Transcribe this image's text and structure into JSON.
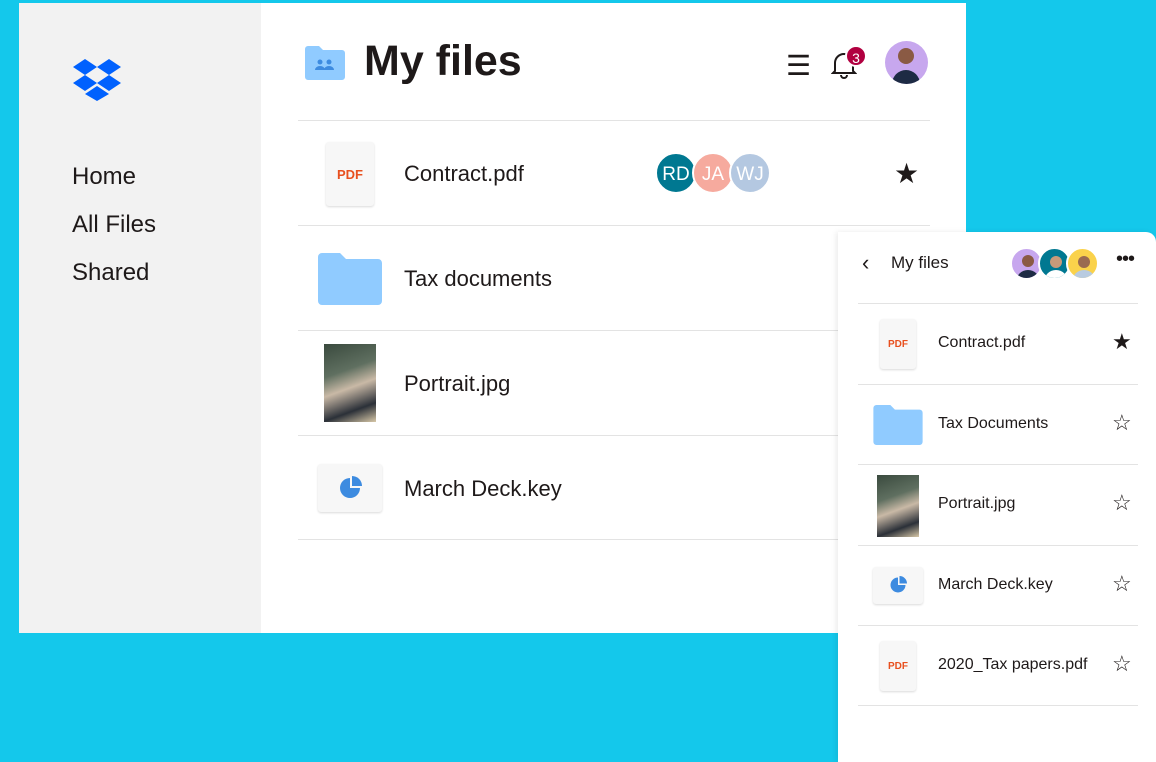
{
  "colors": {
    "background": "#14c8eb",
    "sidebar": "#f2f2f2",
    "brand": "#0061fe",
    "folder": "#90cbff",
    "badge": "#b10040",
    "pdf": "#e8501f"
  },
  "sidebar": {
    "logo": "dropbox-logo",
    "items": [
      {
        "label": "Home"
      },
      {
        "label": "All Files"
      },
      {
        "label": "Shared"
      }
    ]
  },
  "header": {
    "title": "My files",
    "notification_count": "3"
  },
  "files": [
    {
      "name": "Contract.pdf",
      "type": "pdf",
      "icon_text": "PDF",
      "starred": true,
      "shared_with": [
        {
          "initials": "RD",
          "color": "#007891"
        },
        {
          "initials": "JA",
          "color": "#f6aa9e"
        },
        {
          "initials": "WJ",
          "color": "#b4c8e1"
        }
      ]
    },
    {
      "name": "Tax documents",
      "type": "folder",
      "starred": false
    },
    {
      "name": "Portrait.jpg",
      "type": "image",
      "starred": false
    },
    {
      "name": "March Deck.key",
      "type": "keynote",
      "starred": false
    }
  ],
  "panel": {
    "title": "My files",
    "members": [
      {
        "color": "#c7a7ee"
      },
      {
        "color": "#007891"
      },
      {
        "color": "#fad24b"
      }
    ],
    "files": [
      {
        "name": "Contract.pdf",
        "type": "pdf",
        "icon_text": "PDF",
        "starred": true
      },
      {
        "name": "Tax Documents",
        "type": "folder",
        "starred": false
      },
      {
        "name": "Portrait.jpg",
        "type": "image",
        "starred": false
      },
      {
        "name": "March Deck.key",
        "type": "keynote",
        "starred": false
      },
      {
        "name": "2020_Tax papers.pdf",
        "type": "pdf",
        "icon_text": "PDF",
        "starred": false
      }
    ]
  }
}
